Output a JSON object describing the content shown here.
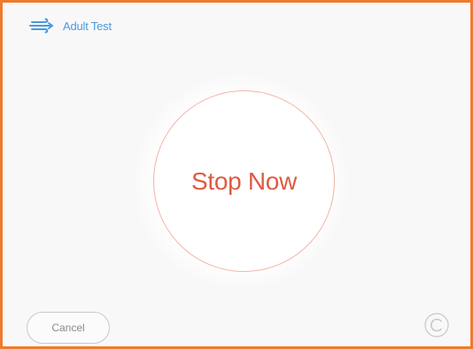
{
  "header": {
    "icon": "lung-airflow-icon",
    "title": "Adult Test"
  },
  "main": {
    "prompt_label": "Stop Now"
  },
  "footer": {
    "cancel_label": "Cancel",
    "refresh_icon": "refresh-icon"
  },
  "colors": {
    "frame_border": "#f07a2e",
    "accent_blue": "#4a9be0",
    "stop_red": "#e05a44",
    "circle_border": "#f3b6ab"
  }
}
